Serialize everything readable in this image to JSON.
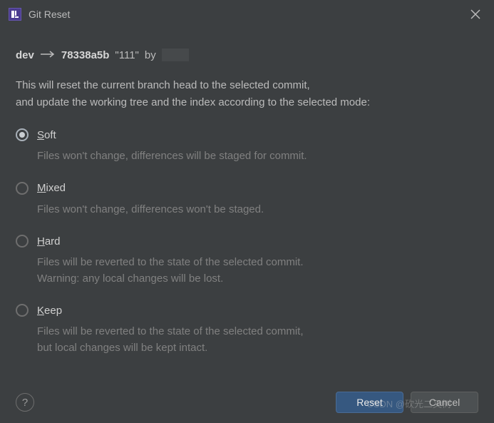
{
  "title": "Git Reset",
  "commit": {
    "branch": "dev",
    "hash": "78338a5b",
    "message": "\"111\"",
    "by": "by"
  },
  "description_line1": "This will reset the current branch head to the selected commit,",
  "description_line2": "and update the working tree and the index according to the selected mode:",
  "options": {
    "soft": {
      "label": "Soft",
      "mnemonic": "S",
      "rest": "oft",
      "desc": "Files won't change, differences will be staged for commit."
    },
    "mixed": {
      "label": "Mixed",
      "mnemonic": "M",
      "rest": "ixed",
      "desc": "Files won't change, differences won't be staged."
    },
    "hard": {
      "label": "Hard",
      "mnemonic": "H",
      "rest": "ard",
      "desc": "Files will be reverted to the state of the selected commit.\nWarning: any local changes will be lost."
    },
    "keep": {
      "label": "Keep",
      "mnemonic": "K",
      "rest": "eep",
      "desc": "Files will be reverted to the state of the selected commit,\nbut local changes will be kept intact."
    }
  },
  "selected": "soft",
  "buttons": {
    "reset": "Reset",
    "cancel": "Cancel",
    "help": "?"
  },
  "watermark": "CSDN @砍光二叉树"
}
